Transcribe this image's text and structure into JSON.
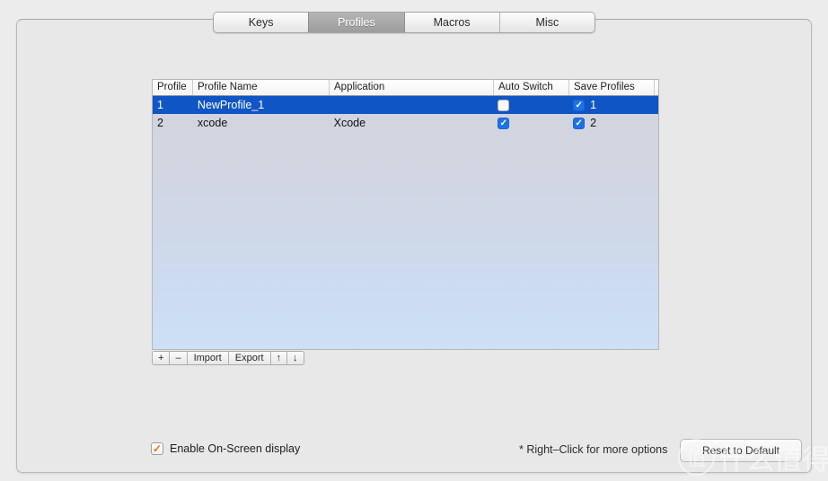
{
  "window": {
    "background_color": "#ececec",
    "panel_color": "#e8e8e8"
  },
  "tabs": [
    {
      "label": "Keys",
      "active": false
    },
    {
      "label": "Profiles",
      "active": true
    },
    {
      "label": "Macros",
      "active": false
    },
    {
      "label": "Misc",
      "active": false
    }
  ],
  "table": {
    "columns": [
      "Profile",
      "Profile Name",
      "Application",
      "Auto Switch",
      "Save Profiles"
    ],
    "rows": [
      {
        "profile": "1",
        "profile_name": "NewProfile_1",
        "application": "",
        "auto_switch": false,
        "save_profiles": true,
        "save_profiles_number": "1",
        "selected": true
      },
      {
        "profile": "2",
        "profile_name": "xcode",
        "application": "Xcode",
        "auto_switch": true,
        "save_profiles": true,
        "save_profiles_number": "2",
        "selected": false
      }
    ],
    "selection_color": "#1055c4",
    "checkbox_on_color": "#1d72e8"
  },
  "table_toolbar": [
    {
      "label": "+",
      "name": "add-profile-button"
    },
    {
      "label": "–",
      "name": "remove-profile-button"
    },
    {
      "label": "Import",
      "name": "import-button"
    },
    {
      "label": "Export",
      "name": "export-button"
    },
    {
      "label": "↑",
      "name": "move-up-button"
    },
    {
      "label": "↓",
      "name": "move-down-button"
    }
  ],
  "footer": {
    "osd_label": "Enable On-Screen display",
    "osd_checked": true,
    "osd_check_color": "#e8730c",
    "hint": "* Right–Click for more options",
    "reset_label": "Reset to Default"
  },
  "watermark": {
    "badge": "值",
    "text": "什么值得买"
  }
}
